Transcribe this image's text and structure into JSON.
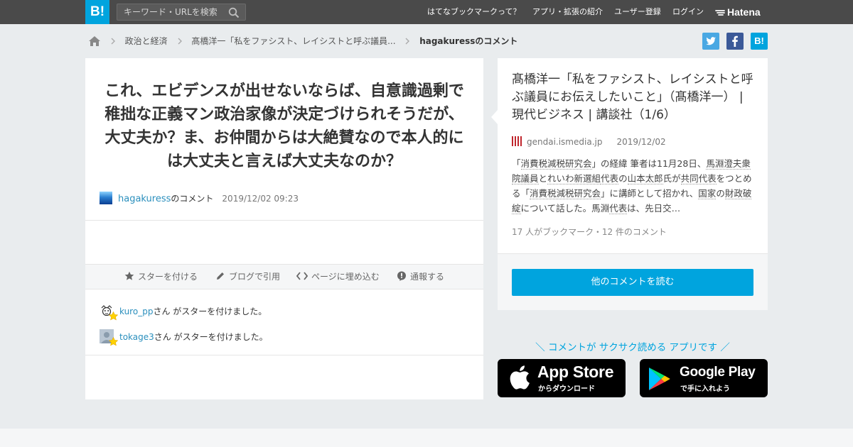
{
  "header": {
    "logo": "B!",
    "search_placeholder": "キーワード・URLを検索",
    "nav": [
      "はてなブックマークって？",
      "アプリ・拡張の紹介",
      "ユーザー登録",
      "ログイン"
    ],
    "brand": "Hatena"
  },
  "breadcrumb": {
    "items": [
      "政治と経済",
      "髙橋洋一「私をファシスト、レイシストと呼ぶ議員...",
      "hagakuressのコメント"
    ]
  },
  "share": {
    "twitter": "twitter-icon",
    "facebook": "facebook-icon",
    "bookmark": "B!"
  },
  "comment": {
    "text": "これ、エビデンスが出せないならば、自意識過剰で稚拙な正義マン政治家像が決定づけられそうだが、大丈夫か？ま、お仲間からは大絶賛なので本人的には大丈夫と言えば大丈夫なのか？",
    "user": "hagakuress",
    "suffix": "のコメント",
    "date": "2019/12/02 09:23"
  },
  "actions": {
    "star": "スターを付ける",
    "blog": "ブログで引用",
    "embed": "ページに埋め込む",
    "report": "通報する"
  },
  "stars": [
    {
      "user": "kuro_pp",
      "text": "さん がスターを付けました。"
    },
    {
      "user": "tokage3",
      "text": "さん がスターを付けました。"
    }
  ],
  "entry": {
    "title": "髙橋洋一「私をファシスト、レイシストと呼ぶ議員にお伝えしたいこと」（髙橋洋一） | 現代ビジネス | 講談社（1/6）",
    "domain": "gendai.ismedia.jp",
    "date": "2019/12/02",
    "desc": {
      "p1": "「",
      "k1": "消費税減税研究会",
      "p2": "」の経緯 筆者は11月28日、",
      "k2": "馬淵澄夫衆院議員",
      "p3": "と",
      "k3": "れいわ新選組",
      "k4": "代表",
      "p4": "の",
      "k5": "山本太郎",
      "p5": "氏が",
      "k6": "共同代表",
      "p6": "をつとめる「",
      "k7": "消費税減税研究会",
      "p7": "」に講師として招かれ、",
      "k8": "国家",
      "p8": "の",
      "k9": "財政破綻",
      "p9": "について話した。馬淵",
      "k10": "代表",
      "p10": "は、先日交…"
    },
    "count": "17 人がブックマーク・12 件のコメント",
    "read_more": "他のコメントを読む"
  },
  "promo": {
    "tagline": "＼ コメントが サクサク読める アプリです ／",
    "appstore_big": "App Store",
    "appstore_sub": "からダウンロード",
    "googleplay_big": "Google Play",
    "googleplay_sub": "で手に入れよう"
  },
  "colors": {
    "accent": "#00a4de",
    "topbar": "#4a4a4a",
    "link": "#2a8fbd",
    "star": "#ffd200"
  }
}
